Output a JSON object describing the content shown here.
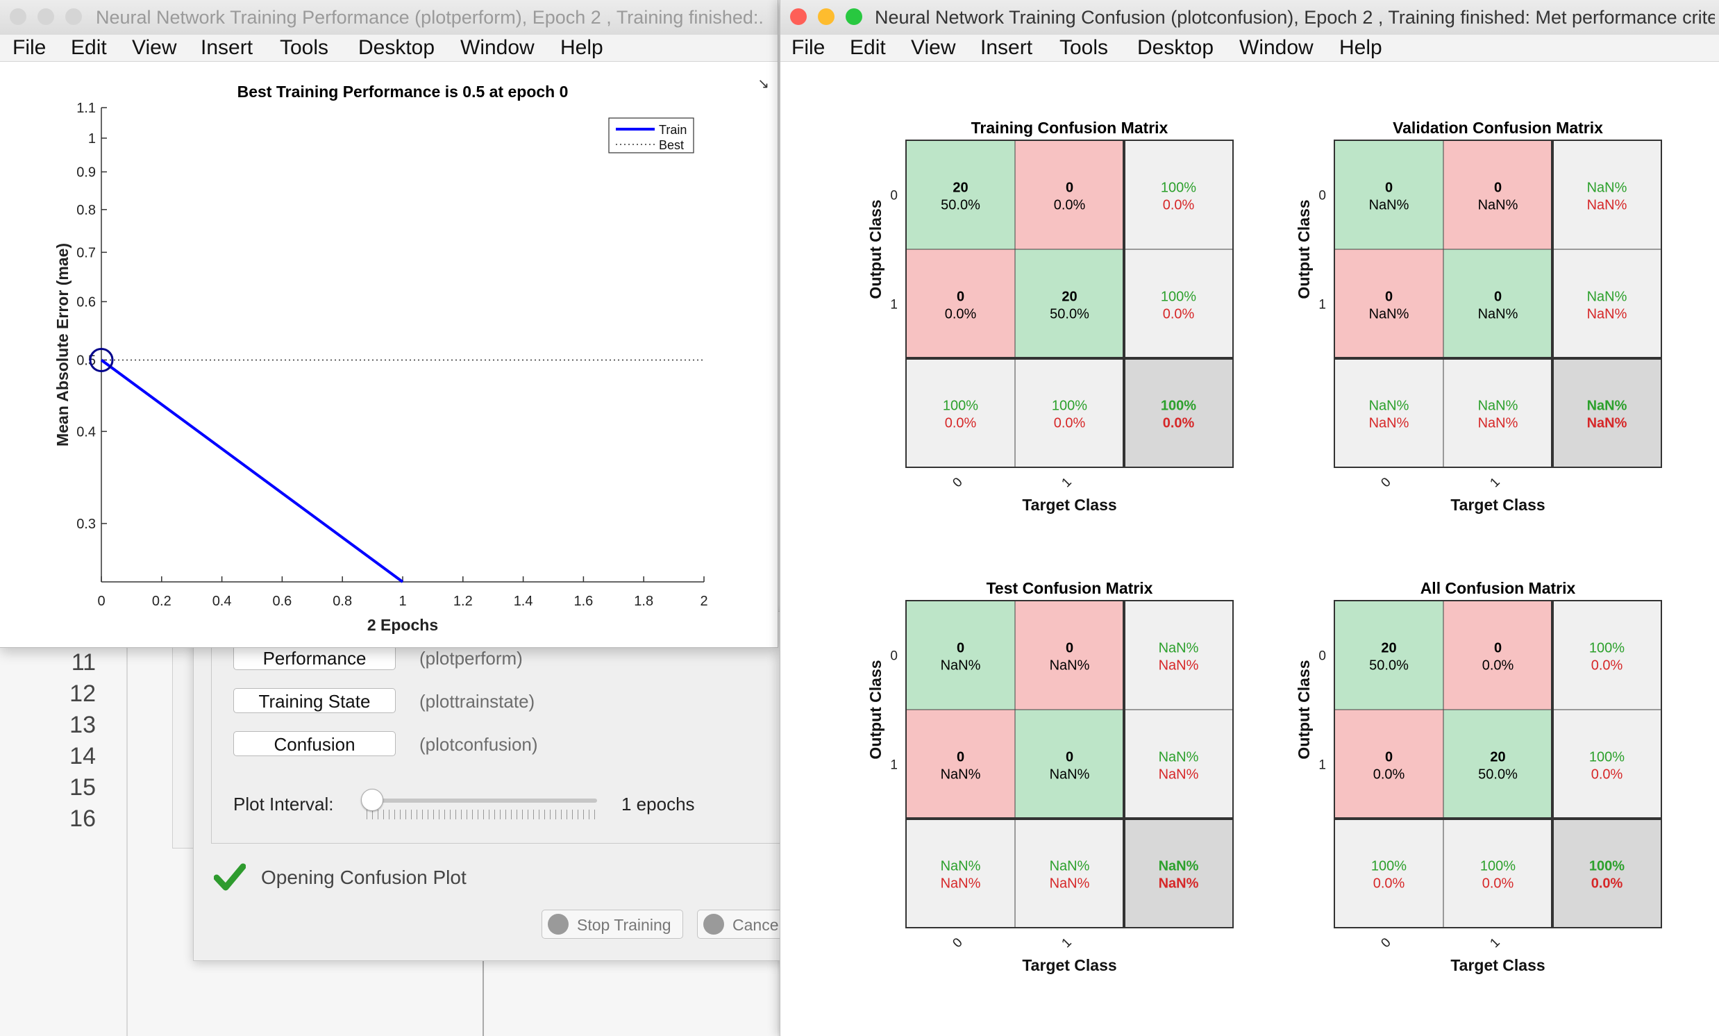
{
  "editor": {
    "line_numbers": [
      "11",
      "12",
      "13",
      "14",
      "15",
      "16"
    ]
  },
  "nntraintool": {
    "plots": [
      {
        "button": "Performance",
        "fn": "(plotperform)"
      },
      {
        "button": "Training State",
        "fn": "(plottrainstate)"
      },
      {
        "button": "Confusion",
        "fn": "(plotconfusion)"
      }
    ],
    "plot_interval_label": "Plot Interval:",
    "plot_interval_value": "1 epochs",
    "status_text": "Opening Confusion Plot",
    "stop_button": "Stop Training",
    "cancel_button": "Cance"
  },
  "perf_window": {
    "title": "Neural Network Training Performance (plotperform), Epoch 2 , Training finished:...",
    "menu": [
      "File",
      "Edit",
      "View",
      "Insert",
      "Tools",
      "Desktop",
      "Window",
      "Help"
    ],
    "dock_icon": "undock-arrow-icon"
  },
  "conf_window": {
    "title": "Neural Network Training Confusion (plotconfusion), Epoch 2 , Training finished: Met performance criteri",
    "menu": [
      "File",
      "Edit",
      "View",
      "Insert",
      "Tools",
      "Desktop",
      "Window",
      "Help"
    ]
  },
  "colors": {
    "correct_cell": "#bde5c8",
    "wrong_cell": "#f7c2c2",
    "summary_cell": "#f0f0f0",
    "total_cell": "#d8d8d8",
    "green_text": "#2ca02c",
    "red_text": "#d62728",
    "train_line": "#0000ff",
    "close": "#fe5f57",
    "minimize": "#febc2e",
    "maximize": "#28c840"
  },
  "chart_data": [
    {
      "type": "line",
      "title": "Best Training Performance is 0.5 at epoch 0",
      "xlabel": "2 Epochs",
      "ylabel": "Mean Absolute Error  (mae)",
      "y_scale": "log",
      "xlim": [
        0,
        2
      ],
      "ylim": [
        0.25,
        1.1
      ],
      "x_ticks": [
        "0",
        "0.2",
        "0.4",
        "0.6",
        "0.8",
        "1",
        "1.2",
        "1.4",
        "1.6",
        "1.8",
        "2"
      ],
      "y_ticks": [
        "0.3",
        "0.4",
        "0.5",
        "0.6",
        "0.7",
        "0.8",
        "0.9",
        "1",
        "1.1"
      ],
      "legend_position": "top-right",
      "series": [
        {
          "name": "Train",
          "style": "solid",
          "x": [
            0,
            1
          ],
          "y": [
            0.5,
            0.25
          ]
        },
        {
          "name": "Best",
          "style": "dotted",
          "x": [
            0,
            2
          ],
          "y": [
            0.5,
            0.5
          ]
        }
      ],
      "best_marker": {
        "x": 0,
        "y": 0.5
      }
    },
    {
      "type": "table",
      "name": "confusion_matrices",
      "output_label": "Output Class",
      "target_label": "Target Class",
      "classes": [
        "0",
        "1"
      ],
      "matrices": [
        {
          "title": "Training Confusion Matrix",
          "counts": [
            [
              "20",
              "0"
            ],
            [
              "0",
              "20"
            ]
          ],
          "pcts": [
            [
              "50.0%",
              "0.0%"
            ],
            [
              "0.0%",
              "50.0%"
            ]
          ],
          "row_summary": [
            [
              "100%",
              "0.0%"
            ],
            [
              "100%",
              "0.0%"
            ]
          ],
          "col_summary": [
            [
              "100%",
              "0.0%"
            ],
            [
              "100%",
              "0.0%"
            ]
          ],
          "total": [
            "100%",
            "0.0%"
          ]
        },
        {
          "title": "Validation Confusion Matrix",
          "counts": [
            [
              "0",
              "0"
            ],
            [
              "0",
              "0"
            ]
          ],
          "pcts": [
            [
              "NaN%",
              "NaN%"
            ],
            [
              "NaN%",
              "NaN%"
            ]
          ],
          "row_summary": [
            [
              "NaN%",
              "NaN%"
            ],
            [
              "NaN%",
              "NaN%"
            ]
          ],
          "col_summary": [
            [
              "NaN%",
              "NaN%"
            ],
            [
              "NaN%",
              "NaN%"
            ]
          ],
          "total": [
            "NaN%",
            "NaN%"
          ]
        },
        {
          "title": "Test Confusion Matrix",
          "counts": [
            [
              "0",
              "0"
            ],
            [
              "0",
              "0"
            ]
          ],
          "pcts": [
            [
              "NaN%",
              "NaN%"
            ],
            [
              "NaN%",
              "NaN%"
            ]
          ],
          "row_summary": [
            [
              "NaN%",
              "NaN%"
            ],
            [
              "NaN%",
              "NaN%"
            ]
          ],
          "col_summary": [
            [
              "NaN%",
              "NaN%"
            ],
            [
              "NaN%",
              "NaN%"
            ]
          ],
          "total": [
            "NaN%",
            "NaN%"
          ]
        },
        {
          "title": "All Confusion Matrix",
          "counts": [
            [
              "20",
              "0"
            ],
            [
              "0",
              "20"
            ]
          ],
          "pcts": [
            [
              "50.0%",
              "0.0%"
            ],
            [
              "0.0%",
              "50.0%"
            ]
          ],
          "row_summary": [
            [
              "100%",
              "0.0%"
            ],
            [
              "100%",
              "0.0%"
            ]
          ],
          "col_summary": [
            [
              "100%",
              "0.0%"
            ],
            [
              "100%",
              "0.0%"
            ]
          ],
          "total": [
            "100%",
            "0.0%"
          ]
        }
      ]
    }
  ]
}
